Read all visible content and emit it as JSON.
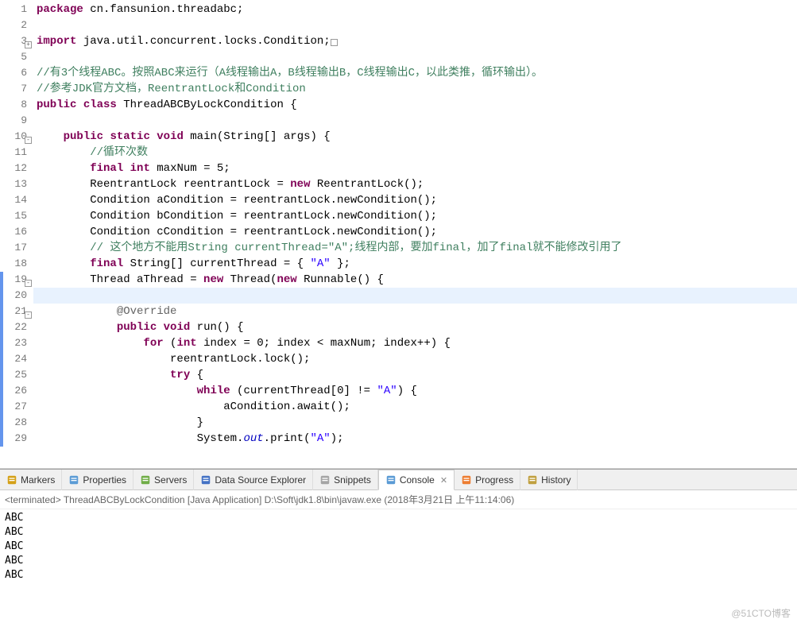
{
  "code": {
    "lines": [
      {
        "n": 1,
        "html": "<span class='kw'>package</span> cn.fansunion.threadabc;"
      },
      {
        "n": 2,
        "html": ""
      },
      {
        "n": 3,
        "fold": "+",
        "html": "<span class='kw'>import</span> java.util.concurrent.locks.Condition;<span class='box-icon'>&nbsp;</span>"
      },
      {
        "n": 5,
        "html": ""
      },
      {
        "n": 6,
        "html": "<span class='cm'>//有3个线程ABC。按照ABC来运行（A线程输出A，B线程输出B，C线程输出C，以此类推，循环输出）。</span>"
      },
      {
        "n": 7,
        "html": "<span class='cm'>//参考JDK官方文档，ReentrantLock和Condition</span>"
      },
      {
        "n": 8,
        "html": "<span class='kw'>public</span> <span class='kw'>class</span> ThreadABCByLockCondition {"
      },
      {
        "n": 9,
        "html": ""
      },
      {
        "n": 10,
        "fold": "-",
        "html": "    <span class='kw'>public</span> <span class='kw'>static</span> <span class='kw'>void</span> main(String[] args) {"
      },
      {
        "n": 11,
        "html": "        <span class='cm'>//循环次数</span>"
      },
      {
        "n": 12,
        "html": "        <span class='kw'>final</span> <span class='kw'>int</span> maxNum = 5;"
      },
      {
        "n": 13,
        "html": "        ReentrantLock reentrantLock = <span class='kw'>new</span> ReentrantLock();"
      },
      {
        "n": 14,
        "html": "        Condition aCondition = reentrantLock.newCondition();"
      },
      {
        "n": 15,
        "html": "        Condition bCondition = reentrantLock.newCondition();"
      },
      {
        "n": 16,
        "html": "        Condition cCondition = reentrantLock.newCondition();"
      },
      {
        "n": 17,
        "html": "        <span class='cm'>// 这个地方不能用String currentThread=\"A\";线程内部，要加final，加了final就不能修改引用了</span>"
      },
      {
        "n": 18,
        "html": "        <span class='kw'>final</span> String[] currentThread = { <span class='str'>\"A\"</span> };"
      },
      {
        "n": 19,
        "fold": "-",
        "bluebar": true,
        "html": "        Thread aThread = <span class='kw'>new</span> Thread(<span class='kw'>new</span> Runnable() {"
      },
      {
        "n": 20,
        "bluebar": true,
        "highlight": true,
        "html": ""
      },
      {
        "n": 21,
        "fold": "-",
        "bluebar": true,
        "html": "            <span class='ann'>@Override</span>"
      },
      {
        "n": 22,
        "bluebar": true,
        "html": "            <span class='kw'>public</span> <span class='kw'>void</span> run() {"
      },
      {
        "n": 23,
        "bluebar": true,
        "html": "                <span class='kw'>for</span> (<span class='kw'>int</span> index = 0; index &lt; maxNum; index++) {"
      },
      {
        "n": 24,
        "bluebar": true,
        "html": "                    reentrantLock.lock();"
      },
      {
        "n": 25,
        "bluebar": true,
        "html": "                    <span class='kw'>try</span> {"
      },
      {
        "n": 26,
        "bluebar": true,
        "html": "                        <span class='kw'>while</span> (currentThread[0] != <span class='str'>\"A\"</span>) {"
      },
      {
        "n": 27,
        "bluebar": true,
        "html": "                            aCondition.await();"
      },
      {
        "n": 28,
        "bluebar": true,
        "html": "                        }"
      },
      {
        "n": 29,
        "bluebar": true,
        "html": "                        System.<span class='static-field'>out</span>.print(<span class='str'>\"A\"</span>);"
      }
    ]
  },
  "tabs": [
    {
      "name": "markers",
      "label": "Markers",
      "icon": "markers"
    },
    {
      "name": "properties",
      "label": "Properties",
      "icon": "properties"
    },
    {
      "name": "servers",
      "label": "Servers",
      "icon": "servers"
    },
    {
      "name": "data-source",
      "label": "Data Source Explorer",
      "icon": "datasource"
    },
    {
      "name": "snippets",
      "label": "Snippets",
      "icon": "snippets"
    },
    {
      "name": "console",
      "label": "Console",
      "icon": "console",
      "active": true,
      "closable": true
    },
    {
      "name": "progress",
      "label": "Progress",
      "icon": "progress"
    },
    {
      "name": "history",
      "label": "History",
      "icon": "history"
    }
  ],
  "console": {
    "status": "<terminated> ThreadABCByLockCondition [Java Application] D:\\Soft\\jdk1.8\\bin\\javaw.exe (2018年3月21日 上午11:14:06)",
    "output": [
      "ABC",
      "ABC",
      "ABC",
      "ABC",
      "ABC"
    ]
  },
  "watermark": "@51CTO博客"
}
